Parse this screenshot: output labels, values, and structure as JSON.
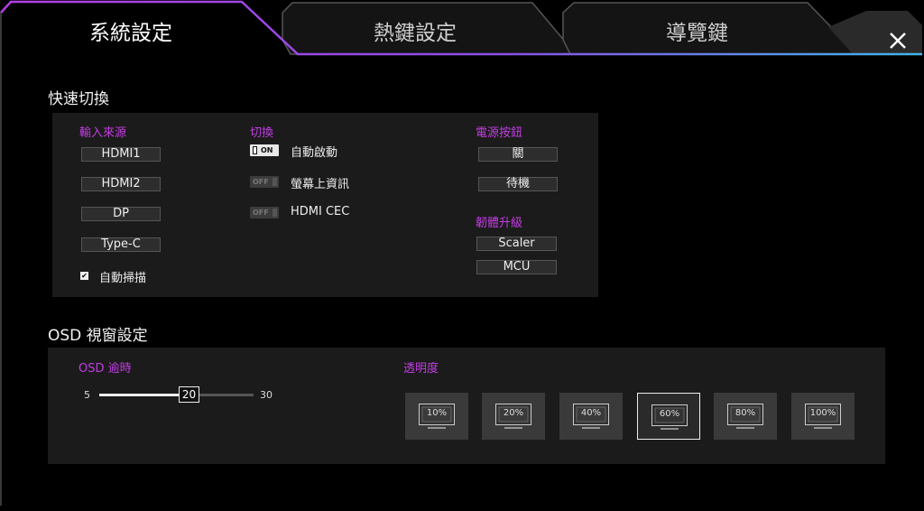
{
  "tabs": [
    {
      "label": "系統設定",
      "active": true
    },
    {
      "label": "熱鍵設定",
      "active": false
    },
    {
      "label": "導覽鍵",
      "active": false
    }
  ],
  "close_icon": "close-icon",
  "quick_switch": {
    "title": "快速切換",
    "input_source": {
      "label": "輸入來源",
      "options": [
        "HDMI1",
        "HDMI2",
        "DP",
        "Type-C"
      ],
      "auto_scan": {
        "label": "自動掃描",
        "checked": true
      }
    },
    "switch": {
      "label": "切換",
      "items": [
        {
          "label": "自動啟動",
          "state": "ON"
        },
        {
          "label": "螢幕上資訊",
          "state": "OFF"
        },
        {
          "label": "HDMI CEC",
          "state": "OFF"
        }
      ]
    },
    "power_button": {
      "label": "電源按鈕",
      "options": [
        "關",
        "待機"
      ]
    },
    "firmware_upgrade": {
      "label": "韌體升級",
      "options": [
        "Scaler",
        "MCU"
      ]
    }
  },
  "osd": {
    "title": "OSD 視窗設定",
    "timeout": {
      "label": "OSD 逾時",
      "min": "5",
      "max": "30",
      "value": "20"
    },
    "transparency": {
      "label": "透明度",
      "options": [
        "10%",
        "20%",
        "40%",
        "60%",
        "80%",
        "100%"
      ],
      "selected": "60%"
    }
  },
  "colors": {
    "accent": "#c33de4",
    "border_gradient": [
      "#c23de8",
      "#4fa3e6"
    ]
  }
}
